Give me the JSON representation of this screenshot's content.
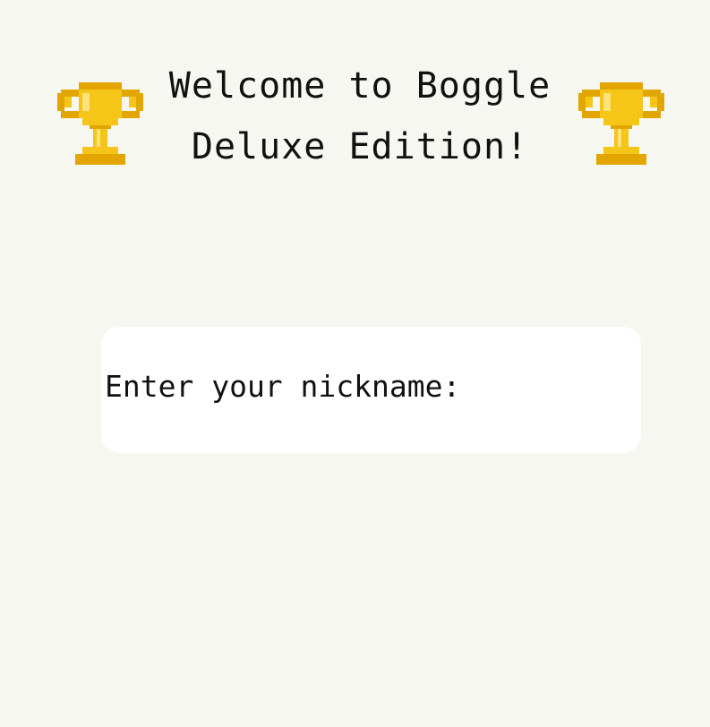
{
  "header": {
    "title_line1": "Welcome to Boggle",
    "title_line2": "Deluxe Edition!",
    "left_icon": "trophy-icon",
    "right_icon": "trophy-icon"
  },
  "nickname": {
    "label": "Enter your nickname:",
    "value": ""
  },
  "colors": {
    "background": "#f6f7f0",
    "card": "#ffffff",
    "text": "#111111",
    "trophy_gold": "#f5c518"
  }
}
